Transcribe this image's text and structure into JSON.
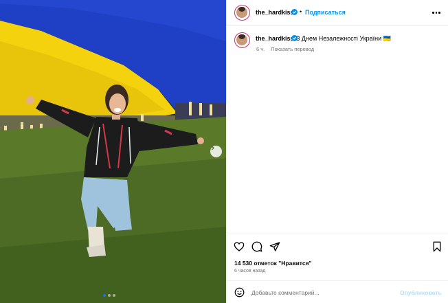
{
  "post": {
    "image_alt": "",
    "carousel": {
      "dots": 3,
      "active_index": 0
    }
  },
  "header": {
    "username": "the_hardkiss",
    "separator": "•",
    "follow_label": "Подписаться",
    "more_icon": "more-horizontal-icon"
  },
  "caption": {
    "username": "the_hardkiss",
    "text": "З Днем Незалежності України 🇺🇦",
    "time": "6 ч.",
    "translate_label": "Показать перевод"
  },
  "actions": {
    "like_icon": "heart-icon",
    "comment_icon": "comment-icon",
    "share_icon": "paper-plane-icon",
    "save_icon": "bookmark-icon"
  },
  "likes": "14 530 отметок \"Нравится\"",
  "time_ago": "6 часов назад",
  "comment": {
    "placeholder": "Добавьте комментарий...",
    "publish_label": "Опубликовать",
    "emoji_icon": "smiley-icon"
  },
  "colors": {
    "flag_blue": "#1f3fc4",
    "flag_yellow": "#f5d30f",
    "link_blue": "#0095f6",
    "publish_disabled": "#b2dffc",
    "muted_text": "#737373"
  }
}
